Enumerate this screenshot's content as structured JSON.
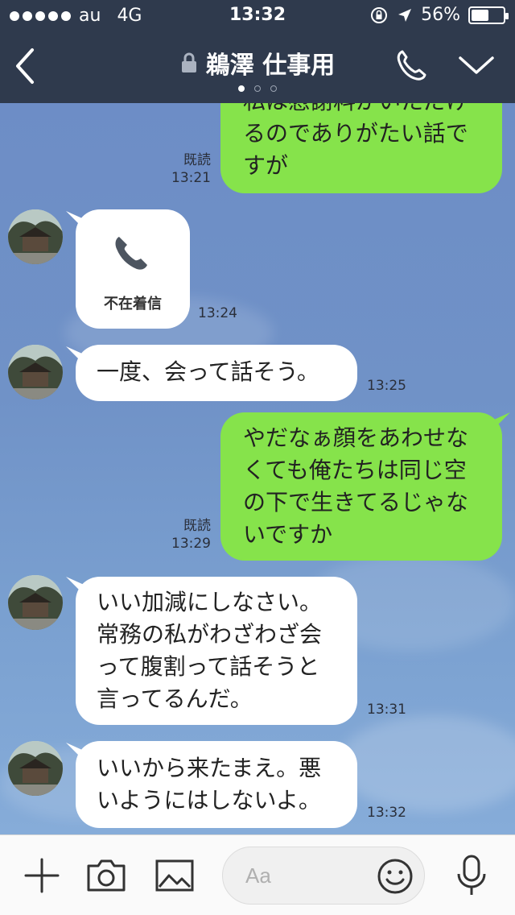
{
  "status_bar": {
    "carrier": "au",
    "network": "4G",
    "time": "13:32",
    "battery": "56%",
    "battery_level": 0.56
  },
  "header": {
    "title": "鵜澤 仕事用",
    "page_count": 3,
    "active_page": 1
  },
  "messages": [
    {
      "side": "out",
      "lines": [
        "私は慰謝料がいただけ",
        "るのでありがたい話で",
        "すが"
      ],
      "read": "既読",
      "time": "13:21"
    },
    {
      "side": "in",
      "type": "missed_call",
      "label": "不在着信",
      "time": "13:24"
    },
    {
      "side": "in",
      "lines": [
        "一度、会って話そう。"
      ],
      "time": "13:25"
    },
    {
      "side": "out",
      "lines": [
        "やだなぁ顔をあわせな",
        "くても俺たちは同じ空",
        "の下で生きてるじゃな",
        "いですか"
      ],
      "read": "既読",
      "time": "13:29"
    },
    {
      "side": "in",
      "lines": [
        "いい加減にしなさい。",
        "常務の私がわざわざ会",
        "って腹割って話そうと",
        "言ってるんだ。"
      ],
      "time": "13:31"
    },
    {
      "side": "in",
      "lines": [
        "いいから来たまえ。悪",
        "いようにはしないよ。"
      ],
      "time": "13:32"
    }
  ],
  "input": {
    "placeholder": "Aa"
  },
  "icons": {
    "back": "chevron-left-icon",
    "lock": "lock-icon",
    "call": "phone-icon",
    "menu": "chevron-down-icon",
    "add": "plus-icon",
    "camera": "camera-icon",
    "image": "image-icon",
    "emoji": "emoji-icon",
    "mic": "microphone-icon"
  },
  "colors": {
    "header_bg": "#2f3a4d",
    "outgoing_bubble": "#86e34b",
    "incoming_bubble": "#ffffff",
    "chat_bg": "#7092c7"
  }
}
